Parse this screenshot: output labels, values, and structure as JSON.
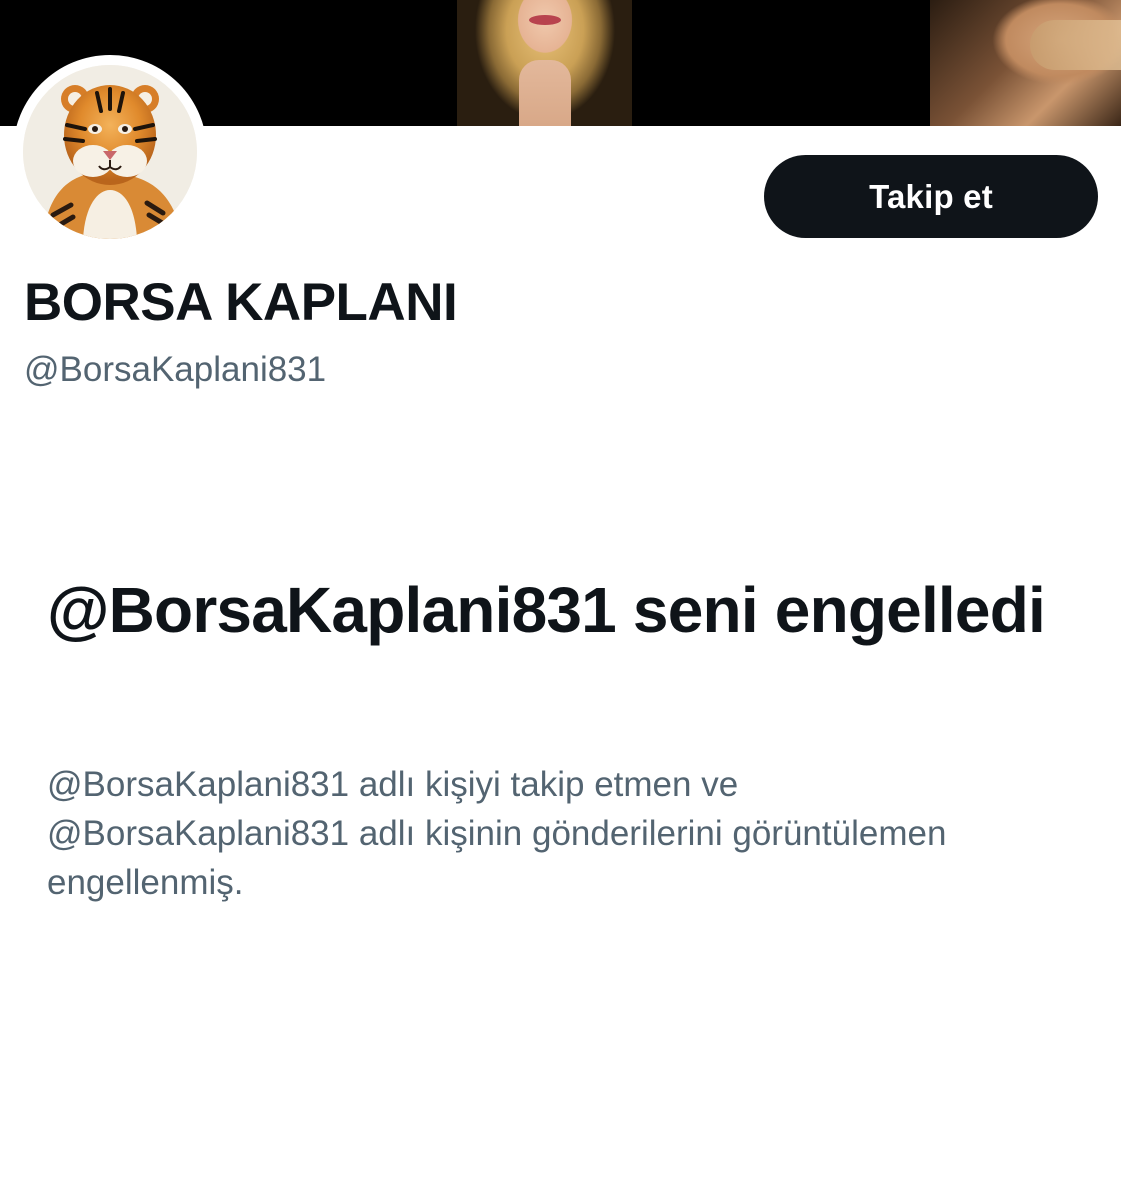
{
  "profile": {
    "display_name": "BORSA KAPLANI",
    "handle": "@BorsaKaplani831"
  },
  "actions": {
    "follow_label": "Takip et"
  },
  "blocked": {
    "title": "@BorsaKaplani831 seni engelledi",
    "description": "@BorsaKaplani831 adlı kişiyi takip etmen ve @BorsaKaplani831 adlı kişinin gönderilerini görüntülemen engellenmiş."
  },
  "colors": {
    "primary_text": "#0f1419",
    "secondary_text": "#536471",
    "button_bg": "#0f1419",
    "button_text": "#ffffff",
    "banner_bg": "#000000"
  },
  "icons": {
    "avatar": "tiger-avatar"
  }
}
